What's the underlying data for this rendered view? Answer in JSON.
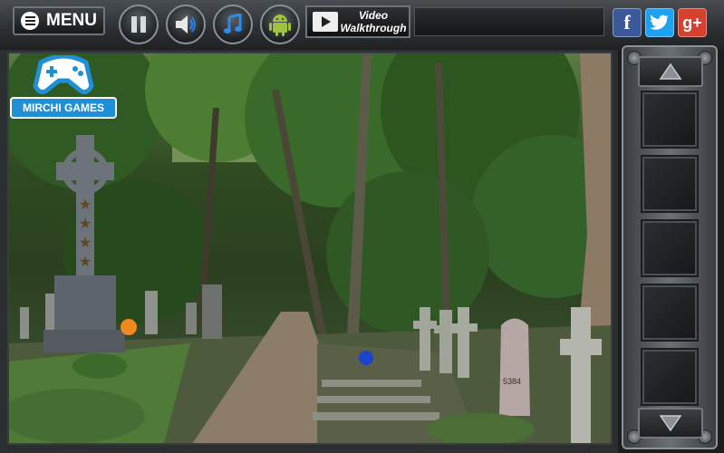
{
  "toolbar": {
    "menu_label": "MENU",
    "video_label_line1": "Video",
    "video_label_line2": "Walkthrough"
  },
  "social": {
    "facebook": "f",
    "twitter": "t",
    "googleplus": "g+"
  },
  "logo": {
    "brand": "MIRCHI GAMES"
  },
  "scene": {
    "headstone_number": "5384"
  },
  "inventory": {
    "slots": [
      "",
      "",
      "",
      "",
      ""
    ]
  },
  "colors": {
    "facebook": "#3b5998",
    "twitter": "#1da1f2",
    "googleplus": "#d6402f",
    "logo_blue": "#1f8fd8",
    "orange_ball": "#f08a1c",
    "blue_ball": "#1a45c8"
  },
  "icons": [
    "menu-icon",
    "pause-icon",
    "sound-icon",
    "music-icon",
    "android-icon",
    "video-icon",
    "up-arrow-icon",
    "down-arrow-icon"
  ]
}
